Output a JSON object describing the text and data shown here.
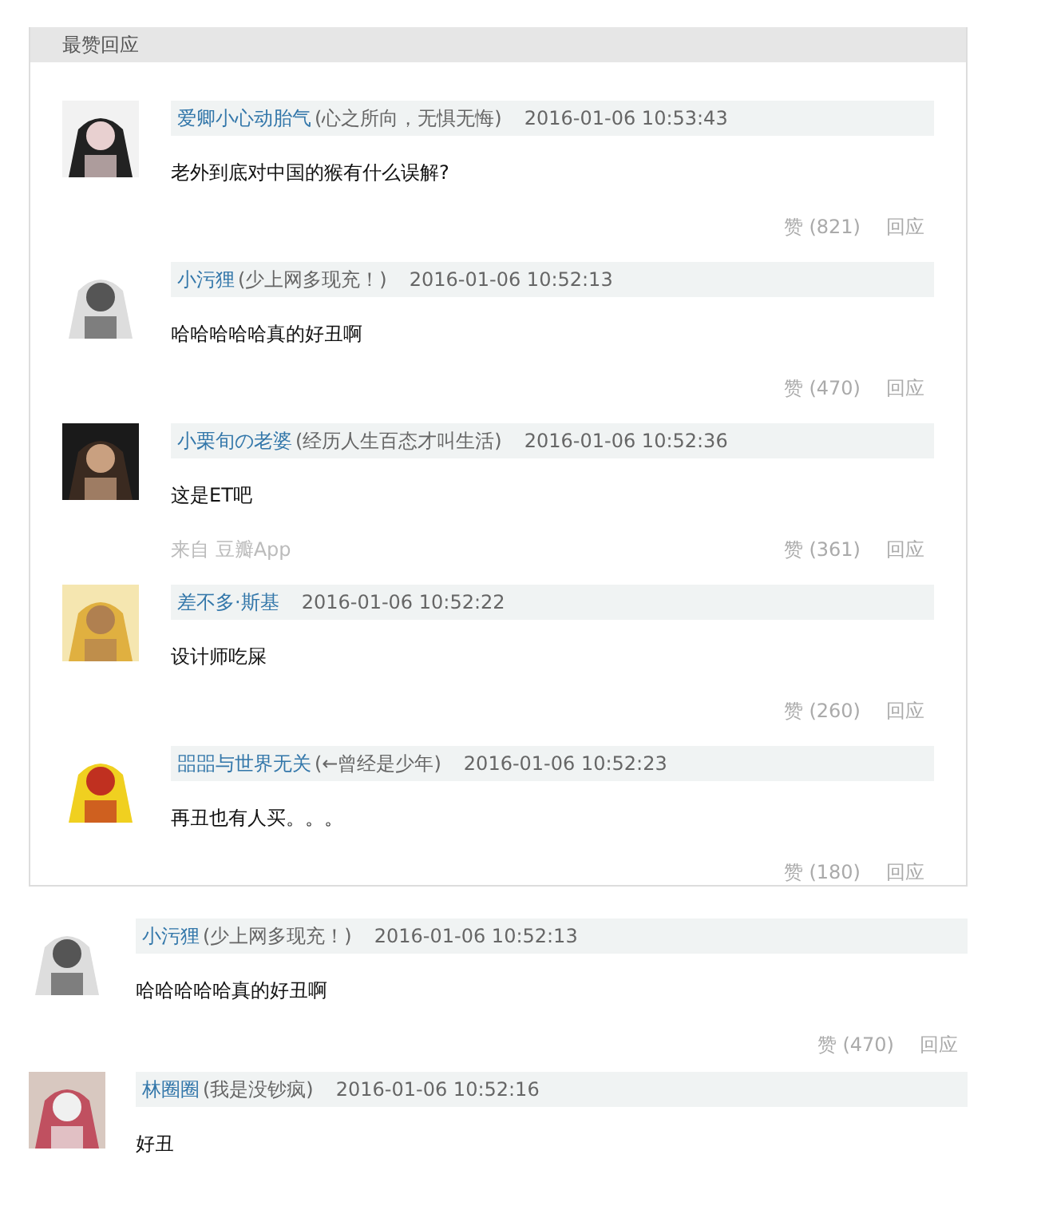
{
  "top_replies": {
    "title": "最赞回应",
    "comments": [
      {
        "user": "爱卿小心动胎气",
        "signature": "(心之所向，无惧无悔)",
        "time": "2016-01-06 10:53:43",
        "text": "老外到底对中国的猴有什么误解?",
        "likes": "赞 (821)",
        "reply": "回应"
      },
      {
        "user": "小污狸",
        "signature": "(少上网多现充！)",
        "time": "2016-01-06 10:52:13",
        "text": "哈哈哈哈哈真的好丑啊",
        "likes": "赞 (470)",
        "reply": "回应"
      },
      {
        "user": "小栗旬の老婆",
        "signature": "(经历人生百态才叫生活)",
        "time": "2016-01-06 10:52:36",
        "text": "这是ET吧",
        "source": "来自 豆瓣App",
        "likes": "赞 (361)",
        "reply": "回应"
      },
      {
        "user": "差不多·斯基",
        "time": "2016-01-06 10:52:22",
        "text": "设计师吃屎",
        "likes": "赞 (260)",
        "reply": "回应"
      },
      {
        "user": "㗊㗊与世界无关",
        "signature": "(←曾经是少年)",
        "time": "2016-01-06 10:52:23",
        "text": "再丑也有人买。。。",
        "likes": "赞 (180)",
        "reply": "回应"
      }
    ]
  },
  "comments": [
    {
      "user": "小污狸",
      "signature": "(少上网多现充！)",
      "time": "2016-01-06 10:52:13",
      "text": "哈哈哈哈哈真的好丑啊",
      "likes": "赞 (470)",
      "reply": "回应"
    },
    {
      "user": "林圈圈",
      "signature": "(我是没钞疯)",
      "time": "2016-01-06 10:52:16",
      "text": "好丑"
    }
  ]
}
